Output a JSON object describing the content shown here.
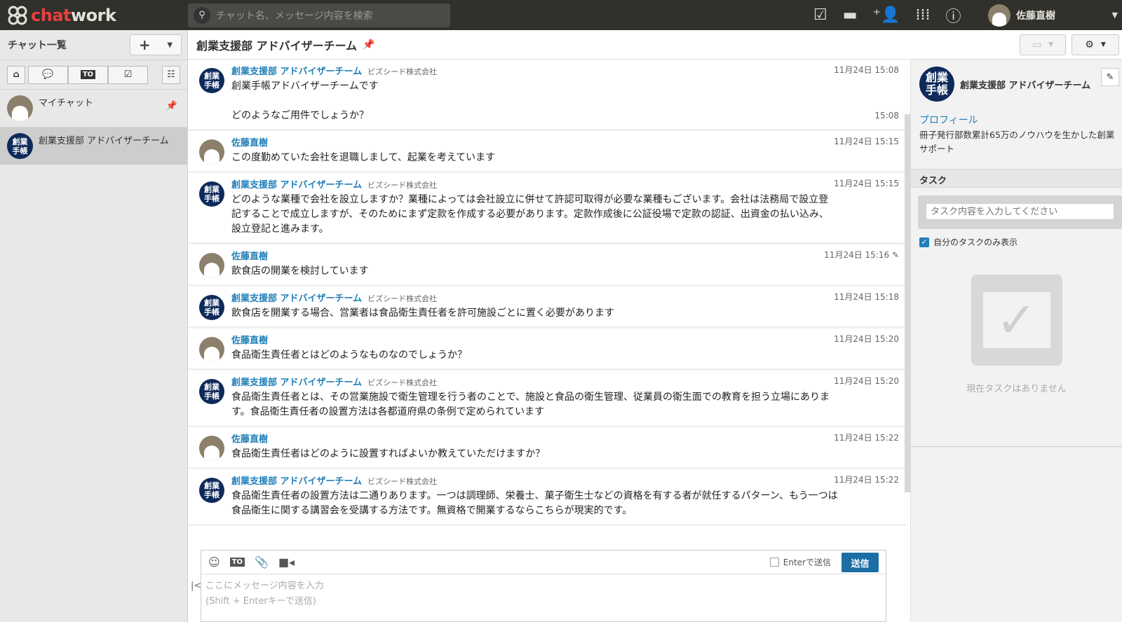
{
  "app": {
    "logo_c": "chat",
    "logo_w": "work",
    "search_placeholder": "チャット名、メッセージ内容を検索",
    "user_name": "佐藤直樹"
  },
  "sidebar": {
    "title": "チャット一覧",
    "add": "+",
    "filters": {
      "to": "TO"
    },
    "rooms": [
      {
        "name": "マイチャット",
        "pinned": true
      },
      {
        "name": "創業支援部 アドバイザーチーム",
        "badge": "創業\n手帳",
        "selected": true
      }
    ]
  },
  "room": {
    "title": "創業支援部 アドバイザーチーム"
  },
  "messages": [
    {
      "sender": "創業支援部 アドバイザーチーム",
      "org": "ビズシード株式会社",
      "time": "11月24日 15:08",
      "lines": [
        "創業手帳アドバイザーチームです"
      ],
      "extra_lines": [
        "どのようなご用件でしょうか？"
      ],
      "extra_time": "15:08",
      "team": true
    },
    {
      "sender": "佐藤直樹",
      "time": "11月24日 15:15",
      "lines": [
        "この度勤めていた会社を退職しまして、起業を考えています"
      ]
    },
    {
      "sender": "創業支援部 アドバイザーチーム",
      "org": "ビズシード株式会社",
      "time": "11月24日 15:15",
      "lines": [
        "どのような業種で会社を設立しますか？業種によっては会社設立に併せて許認可取得が必要な業種もございます。会社は法務局で設立登",
        "記することで成立しますが、そのためにまず定款を作成する必要があります。定款作成後に公証役場で定款の認証、出資金の払い込み、",
        "設立登記と進みます。"
      ],
      "team": true
    },
    {
      "sender": "佐藤直樹",
      "time": "11月24日 15:16",
      "edited": true,
      "lines": [
        "飲食店の開業を検討しています"
      ]
    },
    {
      "sender": "創業支援部 アドバイザーチーム",
      "org": "ビズシード株式会社",
      "time": "11月24日 15:18",
      "lines": [
        "飲食店を開業する場合、営業者は食品衛生責任者を許可施設ごとに置く必要があります"
      ],
      "team": true
    },
    {
      "sender": "佐藤直樹",
      "time": "11月24日 15:20",
      "lines": [
        "食品衛生責任者とはどのようなものなのでしょうか？"
      ]
    },
    {
      "sender": "創業支援部 アドバイザーチーム",
      "org": "ビズシード株式会社",
      "time": "11月24日 15:20",
      "lines": [
        "食品衛生責任者とは、その営業施設で衛生管理を行う者のことで、施設と食品の衛生管理、従業員の衛生面での教育を担う立場にありま",
        "す。食品衛生責任者の設置方法は各都道府県の条例で定められています"
      ],
      "team": true
    },
    {
      "sender": "佐藤直樹",
      "time": "11月24日 15:22",
      "lines": [
        "食品衛生責任者はどのように設置すればよいか教えていただけますか？"
      ]
    },
    {
      "sender": "創業支援部 アドバイザーチーム",
      "org": "ビズシード株式会社",
      "time": "11月24日 15:22",
      "lines": [
        "食品衛生責任者の設置方法は二通りあります。一つは調理師、栄養士、菓子衛生士などの資格を有する者が就任するパターン、もう一つは",
        "食品衛生に関する講習会を受講する方法です。無資格で開業するならこちらが現実的です。"
      ],
      "team": true
    }
  ],
  "badge_text": "創業\n手帳",
  "composer": {
    "to": "TO",
    "enter_send": "Enterで送信",
    "send": "送信",
    "placeholder_1": "ここにメッセージ内容を入力",
    "placeholder_2": "(Shift + Enterキーで送信)"
  },
  "right": {
    "name": "創業支援部 アドバイザーチーム",
    "profile_label": "プロフィール",
    "profile": "冊子発行部数累計65万のノウハウを生かした創業サポート",
    "task_title": "タスク",
    "task_placeholder": "タスク内容を入力してください",
    "own_only": "自分のタスクのみ表示",
    "empty": "現在タスクはありません"
  },
  "colors": {
    "topbar": "#30302c",
    "accent": "#2180b9",
    "send": "#1c6ea4",
    "brand_red": "#e8403c"
  }
}
